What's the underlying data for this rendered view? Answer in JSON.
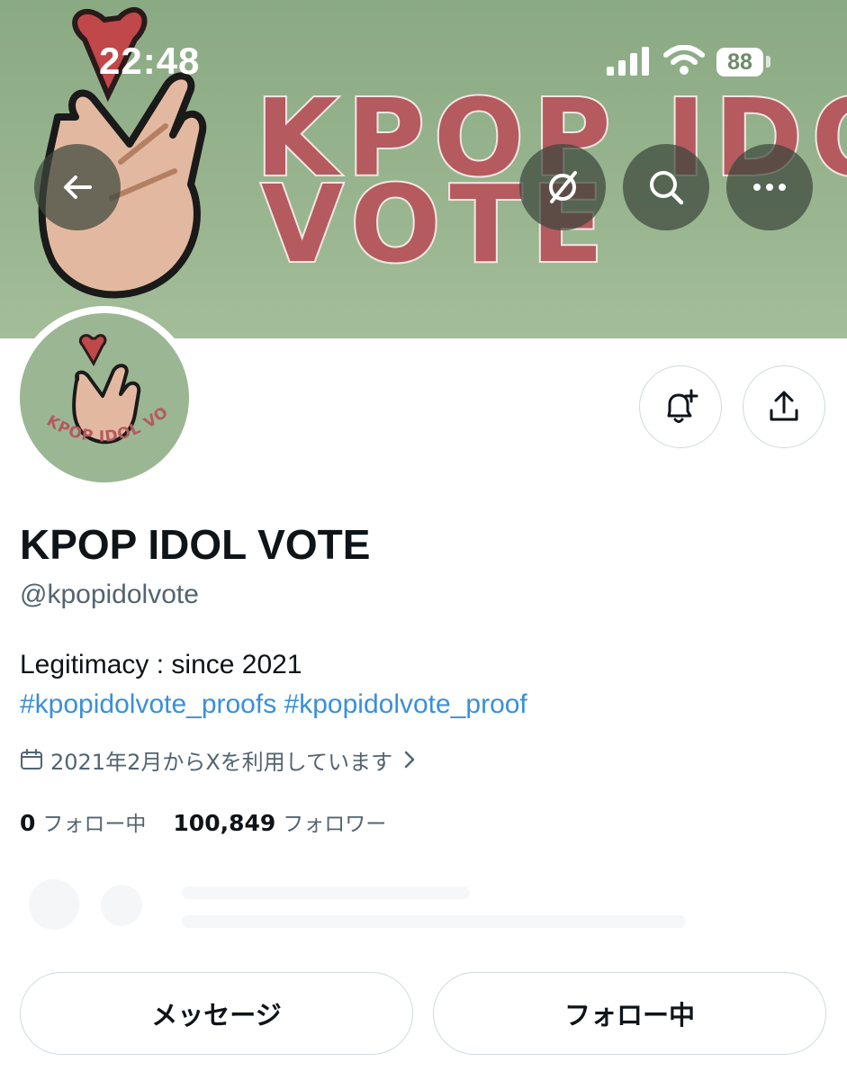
{
  "status_bar": {
    "time": "22:48",
    "battery": "88"
  },
  "banner": {
    "title_line1": "KPOP IDOL",
    "title_line2": "VOTE"
  },
  "avatar": {
    "text": "KPOP IDOL VOTE"
  },
  "profile": {
    "display_name": "KPOP IDOL VOTE",
    "handle": "@kpopidolvote",
    "bio_line": "Legitimacy : since 2021",
    "hashtags": [
      "#kpopidolvote_proofs",
      "#kpopidolvote_proof"
    ],
    "joined": "2021年2月からXを利用しています"
  },
  "stats": {
    "following_count": "0",
    "following_label": "フォロー中",
    "followers_count": "100,849",
    "followers_label": "フォロワー"
  },
  "actions": {
    "message_label": "メッセージ",
    "following_button_label": "フォロー中"
  },
  "colors": {
    "accent": "#1d9bf0",
    "banner_bg": "#93b08b",
    "banner_text": "#b55a5e"
  }
}
